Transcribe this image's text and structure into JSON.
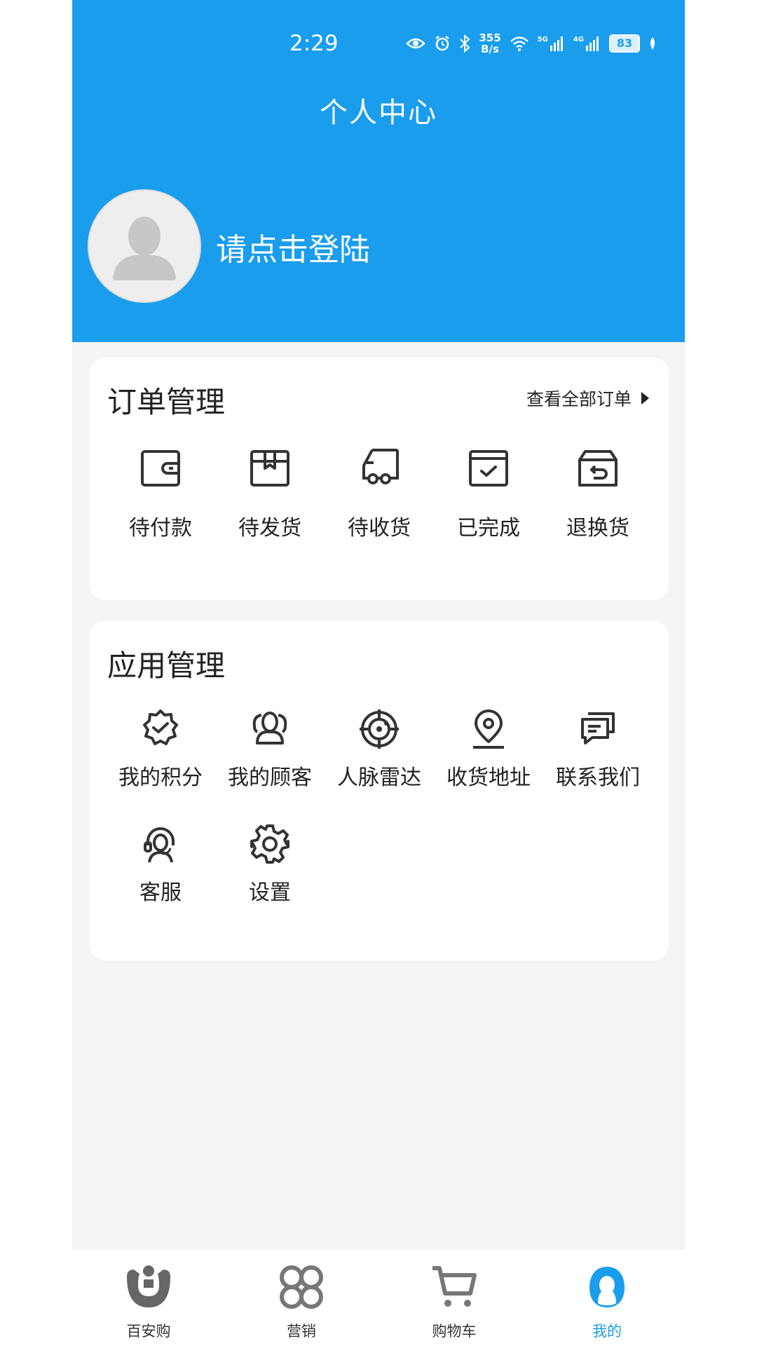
{
  "status_bar": {
    "time": "2:29",
    "net_speed_top": "355",
    "net_speed_bottom": "B/s",
    "net1": "5G",
    "net2": "4G",
    "battery": "83"
  },
  "header": {
    "title": "个人中心",
    "login_prompt": "请点击登陆"
  },
  "orders": {
    "title": "订单管理",
    "view_all": "查看全部订单",
    "items": [
      {
        "label": "待付款",
        "icon": "wallet-icon"
      },
      {
        "label": "待发货",
        "icon": "package-icon"
      },
      {
        "label": "待收货",
        "icon": "truck-icon"
      },
      {
        "label": "已完成",
        "icon": "completed-box-icon"
      },
      {
        "label": "退换货",
        "icon": "return-box-icon"
      }
    ]
  },
  "apps": {
    "title": "应用管理",
    "items": [
      {
        "label": "我的积分",
        "icon": "badge-check-icon"
      },
      {
        "label": "我的顾客",
        "icon": "customers-icon"
      },
      {
        "label": "人脉雷达",
        "icon": "radar-icon"
      },
      {
        "label": "收货地址",
        "icon": "location-pin-icon"
      },
      {
        "label": "联系我们",
        "icon": "message-icon"
      },
      {
        "label": "客服",
        "icon": "headset-icon"
      },
      {
        "label": "设置",
        "icon": "gear-icon"
      }
    ]
  },
  "tabbar": {
    "items": [
      {
        "label": "百安购",
        "icon": "baian-logo-icon"
      },
      {
        "label": "营销",
        "icon": "marketing-icon"
      },
      {
        "label": "购物车",
        "icon": "cart-icon"
      },
      {
        "label": "我的",
        "icon": "profile-icon",
        "active": true
      }
    ]
  },
  "colors": {
    "primary": "#1a9ded",
    "background": "#f4f4f4",
    "card": "#ffffff",
    "icon": "#333333"
  }
}
